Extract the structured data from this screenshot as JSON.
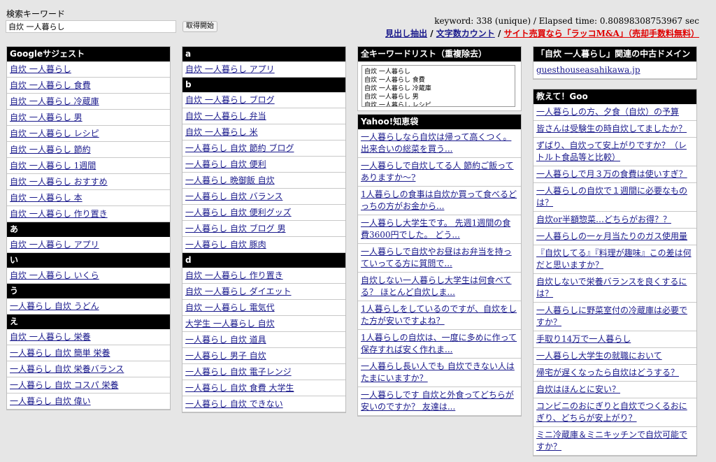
{
  "search": {
    "label": "検索キーワード",
    "value": "自炊 一人暮らし",
    "button": "取得開始"
  },
  "stats": {
    "text": "keyword: 338 (unique) / Elapsed time: 0.80898308753967 sec"
  },
  "toplinks": {
    "link1": "見出し抽出",
    "sep1": " / ",
    "link2": "文字数カウント",
    "sep2": " / ",
    "link3": "サイト売買なら「ラッコM&A」（売却手数料無料）"
  },
  "google": {
    "title": "Googleサジェスト",
    "items": [
      "自炊 一人暮らし",
      "自炊 一人暮らし 食費",
      "自炊 一人暮らし 冷蔵庫",
      "自炊 一人暮らし 男",
      "自炊 一人暮らし レシピ",
      "自炊 一人暮らし 節約",
      "自炊 一人暮らし 1週間",
      "自炊 一人暮らし おすすめ",
      "自炊 一人暮らし 本",
      "自炊 一人暮らし 作り置き"
    ],
    "h_a": "あ",
    "a": [
      "自炊 一人暮らし アプリ"
    ],
    "h_i": "い",
    "i": [
      "自炊 一人暮らし いくら"
    ],
    "h_u": "う",
    "u": [
      "一人暮らし 自炊 うどん"
    ],
    "h_e": "え",
    "e": [
      "自炊 一人暮らし 栄養",
      "一人暮らし 自炊 簡単 栄養",
      "一人暮らし 自炊 栄養バランス",
      "一人暮らし 自炊 コスパ 栄養",
      "一人暮らし 自炊 偉い"
    ]
  },
  "col2": {
    "h_a": "a",
    "a": [
      "自炊 一人暮らし アプリ"
    ],
    "h_b": "b",
    "b": [
      "自炊 一人暮らし ブログ",
      "自炊 一人暮らし 弁当",
      "自炊 一人暮らし 米",
      "一人暮らし 自炊 節約 ブログ",
      "一人暮らし 自炊 便利",
      "一人暮らし 晩御飯 自炊",
      "一人暮らし 自炊 バランス",
      "一人暮らし 自炊 便利グッズ",
      "一人暮らし 自炊 ブログ 男",
      "一人暮らし 自炊 豚肉"
    ],
    "h_d": "d",
    "d": [
      "自炊 一人暮らし 作り置き",
      "自炊 一人暮らし ダイエット",
      "自炊 一人暮らし 電気代",
      "大学生 一人暮らし 自炊",
      "一人暮らし 自炊 道具",
      "一人暮らし 男子 自炊",
      "一人暮らし 自炊 電子レンジ",
      "一人暮らし 自炊 食費 大学生",
      "一人暮らし 自炊 できない"
    ]
  },
  "allkw": {
    "title": "全キーワードリスト（重複除去）",
    "text": "自炊 一人暮らし\n自炊 一人暮らし 食費\n自炊 一人暮らし 冷蔵庫\n自炊 一人暮らし 男\n自炊 一人暮らし レシピ"
  },
  "yahoo": {
    "title": "Yahoo!知恵袋",
    "items": [
      "一人暮らしなら自炊は帰って高くつく。出来合いの総菜を買う...",
      "一人暮らしで自炊してる人 節約ご飯ってありますか〜?",
      "1人暮らしの食事は自炊か買って食べるどっちの方がお金から...",
      "一人暮らし大学生です。 先週1週間の食費3600円でした。 どう...",
      "一人暮らしで自炊やお昼はお弁当を持っていってる方に質問で...",
      "自炊しない一人暮らし大学生は何食べてる？ ほとんど自炊しま...",
      "1人暮らしをしているのですが、自炊をした方が安いですよね？",
      "1人暮らしの自炊は、一度に多めに作って保存すれば安く作れま...",
      "一人暮らし長い人でも 自炊できない人は たまにいますか？",
      "一人暮らしです 自炊と外食ってどちらが安いのですか？ 友達は..."
    ]
  },
  "domain": {
    "title": "「自炊 一人暮らし」関連の中古ドメイン",
    "items": [
      "guesthouseasahikawa.jp"
    ]
  },
  "goo": {
    "title": "教えて！Goo",
    "items": [
      "一人暮らしの方、夕食（自炊）の予算",
      "皆さんは受験生の時自炊してましたか？",
      "ずばり、自炊って安上がりですか？（レトルト食品等と比較）",
      "一人暮らしで月３万の食費は使いすぎ？",
      "一人暮らしの自炊で１週間に必要なものは？",
      "自炊or半額惣菜…どちらがお得？？",
      "一人暮らしの一ヶ月当たりのガス使用量",
      "『自炊してる』『料理が趣味』この差は何だと思いますか？",
      "自炊しないで栄養バランスを良くするには？",
      "一人暮らしに野菜室付の冷蔵庫は必要ですか？",
      "手取り14万で一人暮らし",
      "一人暮らし大学生の就職において",
      "帰宅が遅くなったら自炊はどうする？",
      "自炊はほんとに安い？",
      "コンビニのおにぎりと自炊でつくるおにぎり、どちらが安上がり？",
      "ミニ冷蔵庫＆ミニキッチンで自炊可能ですか？"
    ]
  },
  "colors": {
    "header_bg": "#000000",
    "link": "#1a1a8c",
    "ad_link": "#e00000",
    "page_bg": "#e6e6e6"
  }
}
